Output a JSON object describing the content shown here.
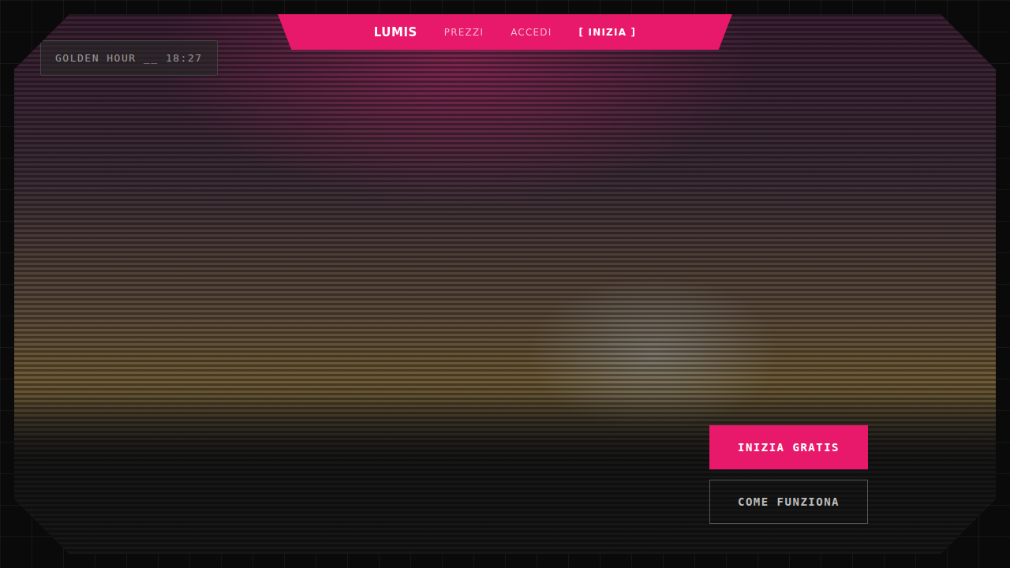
{
  "nav": {
    "items": [
      {
        "label": "LUMIS",
        "kind": "brand"
      },
      {
        "label": "PREZZI",
        "kind": "link"
      },
      {
        "label": "ACCEDI",
        "kind": "link"
      },
      {
        "label": "[ INIZIA ]",
        "kind": "cta"
      }
    ]
  },
  "hero": {
    "badge": "GOLDEN HOUR __ 18:27",
    "buttons": [
      {
        "label": "INIZIA GRATIS",
        "kind": "primary"
      },
      {
        "label": "COME FUNZIONA",
        "kind": "secondary"
      }
    ]
  }
}
